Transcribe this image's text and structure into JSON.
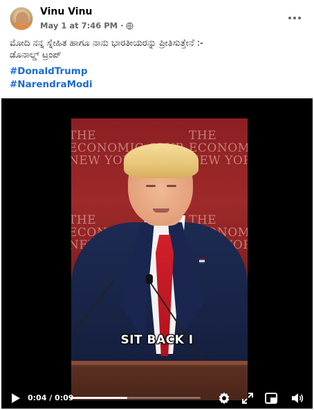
{
  "post": {
    "author": "Vinu Vinu",
    "timestamp": "May 1 at 7:46 PM",
    "separator": "·",
    "audience_icon": "globe-icon",
    "text_line1": "ಮೋದಿ ನನ್ನ ಸ್ನೇಹಿತ ಹಾಗೂ ನಾನು ಭಾರತೀಯರನ್ನು ಪ್ರೀತಿಸುತ್ತೇನೆ  :-",
    "text_line2": "ಡೊನಾಲ್ಡ್ ಟ್ರಂಪ್",
    "hashtags": [
      "#DonaldTrump",
      "#NarendraModi"
    ]
  },
  "video": {
    "caption": "SIT BACK I",
    "backdrop_sign": "THE\nECONOMIC CLUB\nNEW YORK",
    "current_time": "0:04",
    "duration": "0:09",
    "time_display": "0:04 / 0:09",
    "progress_fraction": 0.44
  },
  "colors": {
    "hashtag": "#1b6cd0",
    "meta_text": "#65676b",
    "video_bg": "#000000"
  }
}
